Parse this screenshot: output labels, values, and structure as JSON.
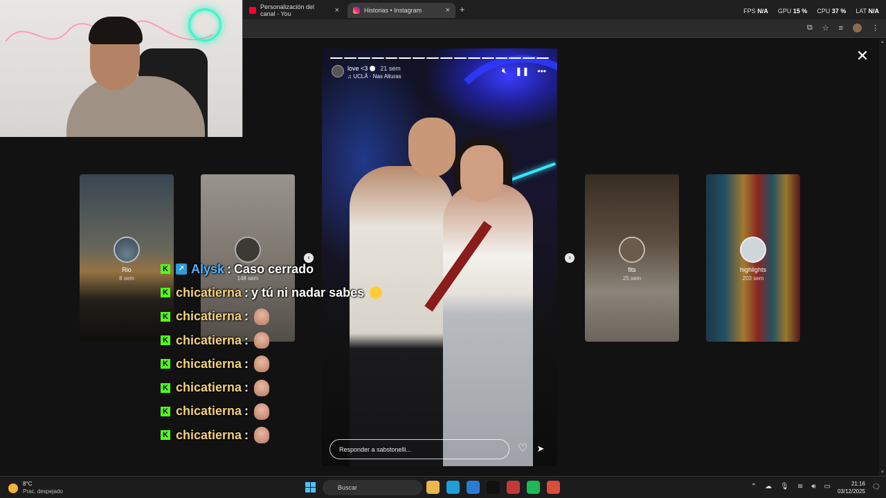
{
  "browser": {
    "tabs": [
      {
        "title": "Personalización del canal - You",
        "icon": "youtube-icon"
      },
      {
        "title": "Historias • Instagram",
        "icon": "instagram-icon"
      }
    ],
    "perf": {
      "fps_label": "FPS",
      "fps_value": "N/A",
      "gpu_label": "GPU",
      "gpu_value": "15 %",
      "cpu_label": "CPU",
      "cpu_value": "37 %",
      "lat_label": "LAT",
      "lat_value": "N/A"
    }
  },
  "story": {
    "username": "love <3",
    "time": "21 sem",
    "music": "UCLÃ · Nas Alturas",
    "reply_placeholder": "Responder a sabstonelli...",
    "progress_total": 16,
    "progress_done": 16
  },
  "previews": [
    {
      "name": "Rio",
      "time": "8 sem"
    },
    {
      "name": "",
      "time": "148 sem"
    },
    {
      "name": "fits",
      "time": "25 sem"
    },
    {
      "name": "highlights",
      "time": "203 sem"
    }
  ],
  "chat": [
    {
      "user": "Alysk",
      "sep": ":",
      "message": "Caso cerrado",
      "user_color": "#4fb3ff",
      "badge": "tool-badge-icon",
      "emote": false,
      "emoji": false
    },
    {
      "user": "chicatierna",
      "sep": ":",
      "message": "y tú ni nadar sabes",
      "user_color": "#f3d27a",
      "emoji": true,
      "emote": false
    },
    {
      "user": "chicatierna",
      "sep": ":",
      "message": "",
      "user_color": "#f3d27a",
      "emote": true
    },
    {
      "user": "chicatierna",
      "sep": ":",
      "message": "",
      "user_color": "#f3d27a",
      "emote": true
    },
    {
      "user": "chicatierna",
      "sep": ":",
      "message": "",
      "user_color": "#f3d27a",
      "emote": true
    },
    {
      "user": "chicatierna",
      "sep": ":",
      "message": "",
      "user_color": "#f3d27a",
      "emote": true
    },
    {
      "user": "chicatierna",
      "sep": ":",
      "message": "",
      "user_color": "#f3d27a",
      "emote": true
    },
    {
      "user": "chicatierna",
      "sep": ":",
      "message": "",
      "user_color": "#f3d27a",
      "emote": true
    }
  ],
  "taskbar": {
    "weather_temp": "8°C",
    "weather_desc": "Prac. despejado",
    "search_placeholder": "Buscar",
    "time": "21:16",
    "date": "03/12/2025",
    "apps": [
      {
        "name": "file-explorer-icon",
        "color": "#e8b84a"
      },
      {
        "name": "edge-icon",
        "color": "#1f9ed8"
      },
      {
        "name": "store-icon",
        "color": "#2a7dd4"
      },
      {
        "name": "yahoo-icon",
        "color": "#111111"
      },
      {
        "name": "app-icon",
        "color": "#c23a3a"
      },
      {
        "name": "spotify-icon",
        "color": "#1db954"
      },
      {
        "name": "chrome-icon",
        "color": "#dd4b39"
      }
    ]
  },
  "colors": {
    "kick_green": "#53fc18",
    "instagram_accent": "#ee2a7b"
  }
}
